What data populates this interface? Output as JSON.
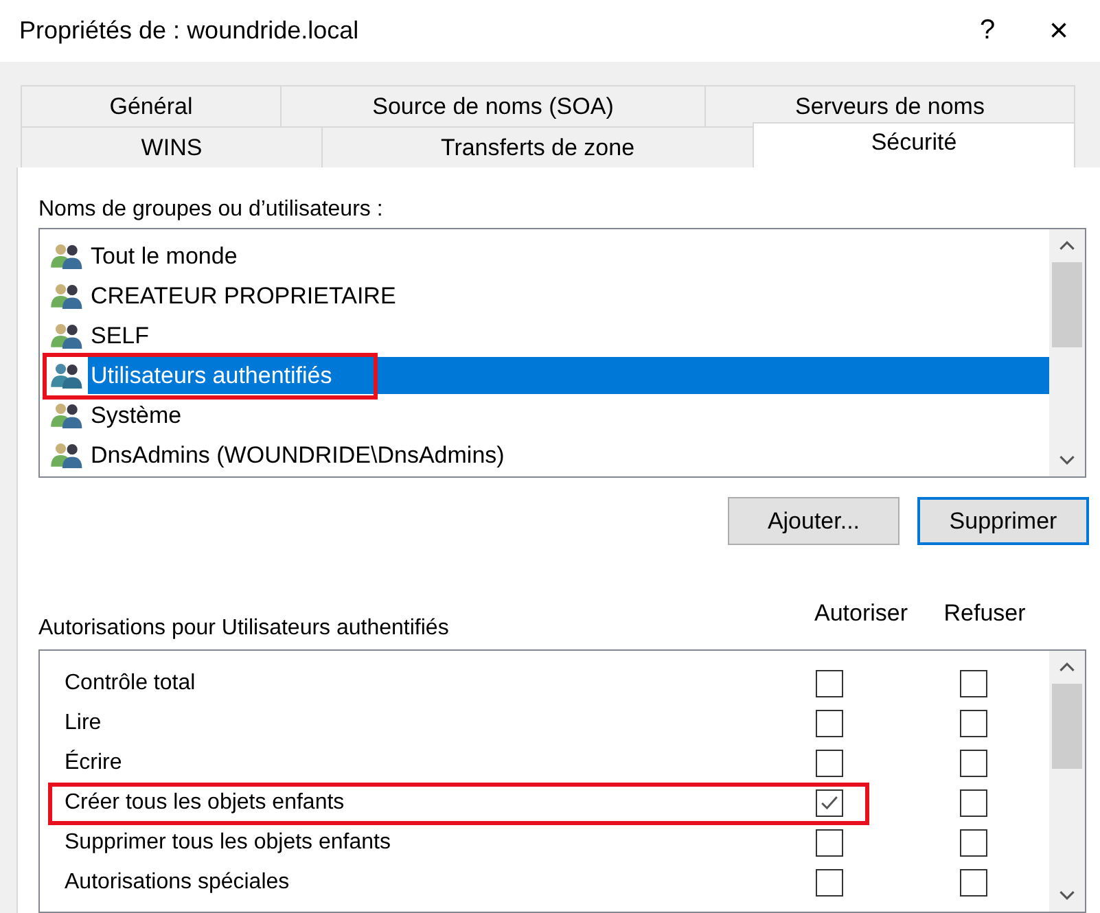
{
  "window": {
    "title": "Propriétés de : woundride.local",
    "help": "?",
    "close": "×"
  },
  "tabs": [
    [
      {
        "label": "Général",
        "selected": false
      },
      {
        "label": "Source de noms (SOA)",
        "selected": false
      },
      {
        "label": "Serveurs de noms",
        "selected": false
      }
    ],
    [
      {
        "label": "WINS",
        "selected": false
      },
      {
        "label": "Transferts de zone",
        "selected": false
      },
      {
        "label": "Sécurité",
        "selected": true
      }
    ]
  ],
  "principals": {
    "label": "Noms de groupes ou d’utilisateurs :",
    "items": [
      {
        "name": "Tout le monde",
        "selected": false,
        "highlighted": false
      },
      {
        "name": "CREATEUR PROPRIETAIRE",
        "selected": false,
        "highlighted": false
      },
      {
        "name": "SELF",
        "selected": false,
        "highlighted": false
      },
      {
        "name": "Utilisateurs authentifiés",
        "selected": true,
        "highlighted": true
      },
      {
        "name": "Système",
        "selected": false,
        "highlighted": false
      },
      {
        "name": "DnsAdmins (WOUNDRIDE\\DnsAdmins)",
        "selected": false,
        "highlighted": false
      }
    ]
  },
  "buttons": [
    {
      "label": "Ajouter...",
      "default": false
    },
    {
      "label": "Supprimer",
      "default": true
    }
  ],
  "permissions": {
    "label": "Autorisations pour Utilisateurs authentifiés",
    "columns": [
      "Autoriser",
      "Refuser"
    ],
    "rows": [
      {
        "name": "Contrôle total",
        "allow": false,
        "deny": false,
        "highlighted": false
      },
      {
        "name": "Lire",
        "allow": false,
        "deny": false,
        "highlighted": false
      },
      {
        "name": "Écrire",
        "allow": false,
        "deny": false,
        "highlighted": false
      },
      {
        "name": "Créer tous les objets enfants",
        "allow": true,
        "deny": false,
        "highlighted": true
      },
      {
        "name": "Supprimer tous les objets enfants",
        "allow": false,
        "deny": false,
        "highlighted": false
      },
      {
        "name": "Autorisations spéciales",
        "allow": false,
        "deny": false,
        "highlighted": false
      }
    ]
  }
}
